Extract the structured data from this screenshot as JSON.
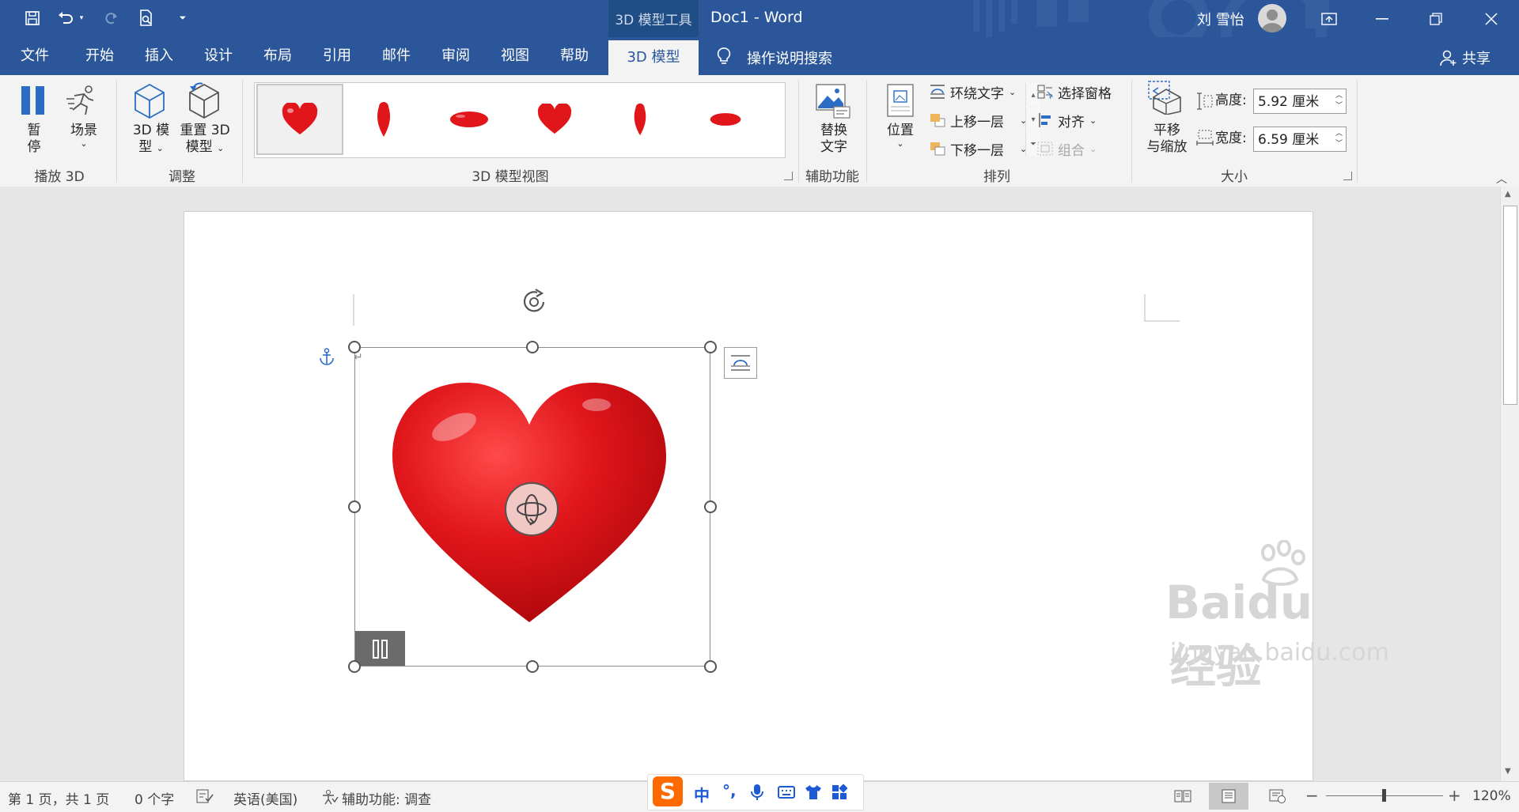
{
  "window": {
    "context_tab_title": "3D 模型工具",
    "doc_title": "Doc1  -  Word",
    "user_name": "刘 雪怡"
  },
  "tabs": [
    {
      "label": "文件"
    },
    {
      "label": "开始"
    },
    {
      "label": "插入"
    },
    {
      "label": "设计"
    },
    {
      "label": "布局"
    },
    {
      "label": "引用"
    },
    {
      "label": "邮件"
    },
    {
      "label": "审阅"
    },
    {
      "label": "视图"
    },
    {
      "label": "帮助"
    }
  ],
  "active_tab": "3D 模型",
  "search_label": "操作说明搜索",
  "share_label": "共享",
  "ribbon": {
    "play3d": {
      "pause_label_1": "暂",
      "pause_label_2": "停",
      "scene_label": "场景",
      "group": "播放 3D"
    },
    "adjust": {
      "model_label_1": "3D 模",
      "model_label_2": "型",
      "reset_label_1": "重置 3D",
      "reset_label_2": "模型",
      "group": "调整"
    },
    "views": {
      "group": "3D 模型视图"
    },
    "accessibility": {
      "alt_label_1": "替换",
      "alt_label_2": "文字",
      "group": "辅助功能"
    },
    "arrange": {
      "position_label": "位置",
      "wrap_text": "环绕文字",
      "bring_forward": "上移一层",
      "send_backward": "下移一层",
      "selection_pane": "选择窗格",
      "align": "对齐",
      "group_obj": "组合",
      "group": "排列"
    },
    "size": {
      "pan_zoom_1": "平移",
      "pan_zoom_2": "与缩放",
      "height_label": "高度:",
      "height_value": "5.92 厘米",
      "width_label": "宽度:",
      "width_value": "6.59 厘米",
      "group": "大小"
    }
  },
  "status": {
    "page": "第 1 页，共 1 页",
    "words": "0 个字",
    "language": "英语(美国)",
    "accessibility": "辅助功能: 调查",
    "zoom": "120%"
  },
  "ime": {
    "mode": "中",
    "punct": "°,"
  },
  "watermark": {
    "brand": "Baidu",
    "brand_cn": "经验",
    "url": "jingyan.baidu.com"
  },
  "colors": {
    "accent": "#2b579a",
    "heart": "#e0161b"
  }
}
